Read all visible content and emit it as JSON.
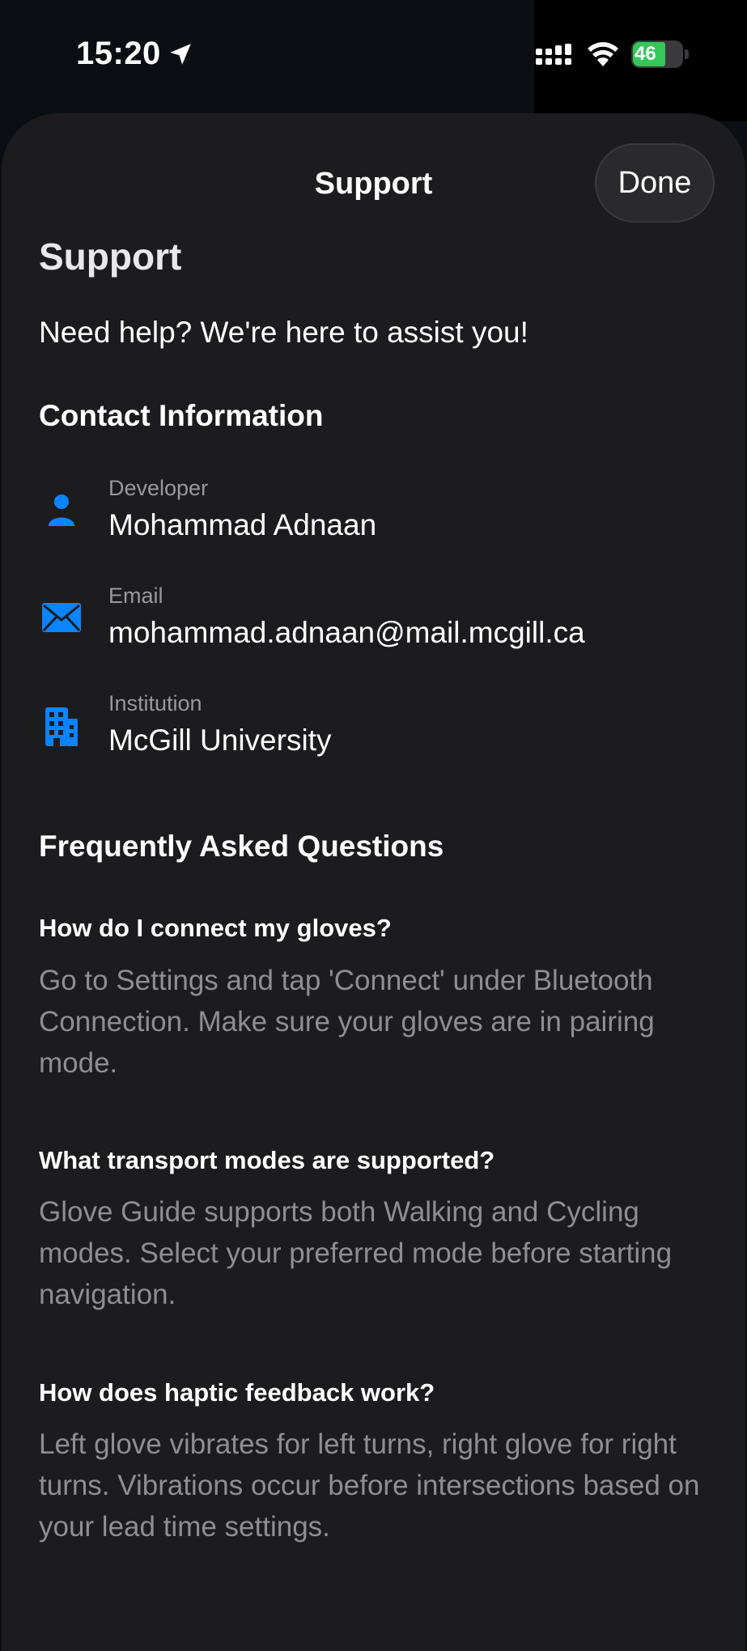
{
  "status_bar": {
    "time": "15:20",
    "battery": "46"
  },
  "nav": {
    "title": "Support",
    "done_label": "Done"
  },
  "page": {
    "large_title": "Support",
    "subtitle": "Need help? We're here to assist you!"
  },
  "contact": {
    "header": "Contact Information",
    "items": [
      {
        "icon": "person-icon",
        "label": "Developer",
        "value": "Mohammad Adnaan"
      },
      {
        "icon": "envelope-icon",
        "label": "Email",
        "value": "mohammad.adnaan@mail.mcgill.ca"
      },
      {
        "icon": "building-icon",
        "label": "Institution",
        "value": "McGill University"
      }
    ]
  },
  "faq": {
    "header": "Frequently Asked Questions",
    "items": [
      {
        "question": "How do I connect my gloves?",
        "answer": "Go to Settings and tap 'Connect' under Bluetooth Connection. Make sure your gloves are in pairing mode."
      },
      {
        "question": "What transport modes are supported?",
        "answer": "Glove Guide supports both Walking and Cycling modes. Select your preferred mode before starting navigation."
      },
      {
        "question": "How does haptic feedback work?",
        "answer": "Left glove vibrates for left turns, right glove for right turns. Vibrations occur before intersections based on your lead time settings."
      }
    ]
  },
  "colors": {
    "accent": "#0a84ff",
    "sheet_background": "#1c1c1e",
    "secondary_text": "#8e8e93"
  }
}
